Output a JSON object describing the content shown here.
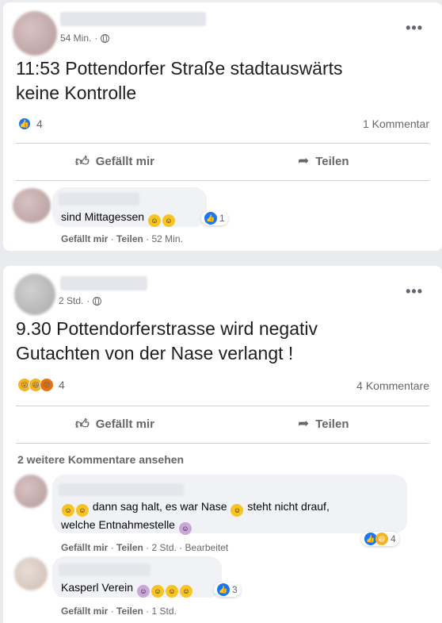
{
  "post1": {
    "time": "54 Min.",
    "text_line1": "11:53 Pottendorfer Straße stadtauswärts",
    "text_line2": "keine Kontrolle",
    "reaction_count": "4",
    "comment_count": "1 Kommentar",
    "like_label": "Gefällt mir",
    "share_label": "Teilen",
    "comment": {
      "text": "sind Mittagessen",
      "reaction_count": "1",
      "like_label": "Gefällt mir",
      "reply_label": "Teilen",
      "time": "52 Min."
    }
  },
  "post2": {
    "time": "2 Std.",
    "text_line1": "9.30 Pottendorferstrasse wird negativ",
    "text_line2": "Gutachten von der Nase verlangt !",
    "reaction_count": "4",
    "comment_count": "4 Kommentare",
    "like_label": "Gefällt mir",
    "share_label": "Teilen",
    "see_more": "2 weitere Kommentare ansehen",
    "comment1": {
      "text_part1": "dann sag halt, es war Nase",
      "text_part2": "steht nicht drauf,",
      "text_line2": "welche Entnahmestelle",
      "reaction_count": "4",
      "like_label": "Gefällt mir",
      "reply_label": "Teilen",
      "time": "2 Std.",
      "edited": "Bearbeitet"
    },
    "comment2": {
      "text": "Kasperl Verein",
      "reaction_count": "3",
      "like_label": "Gefällt mir",
      "reply_label": "Teilen",
      "time": "1 Std."
    }
  },
  "icons": {
    "more": "more-icon",
    "like": "thumbs-up-icon",
    "share": "share-arrow-icon",
    "globe": "globe-icon"
  },
  "colors": {
    "background": "#e9ebee",
    "like_blue": "#1877f2",
    "secondary_text": "#65676b"
  }
}
